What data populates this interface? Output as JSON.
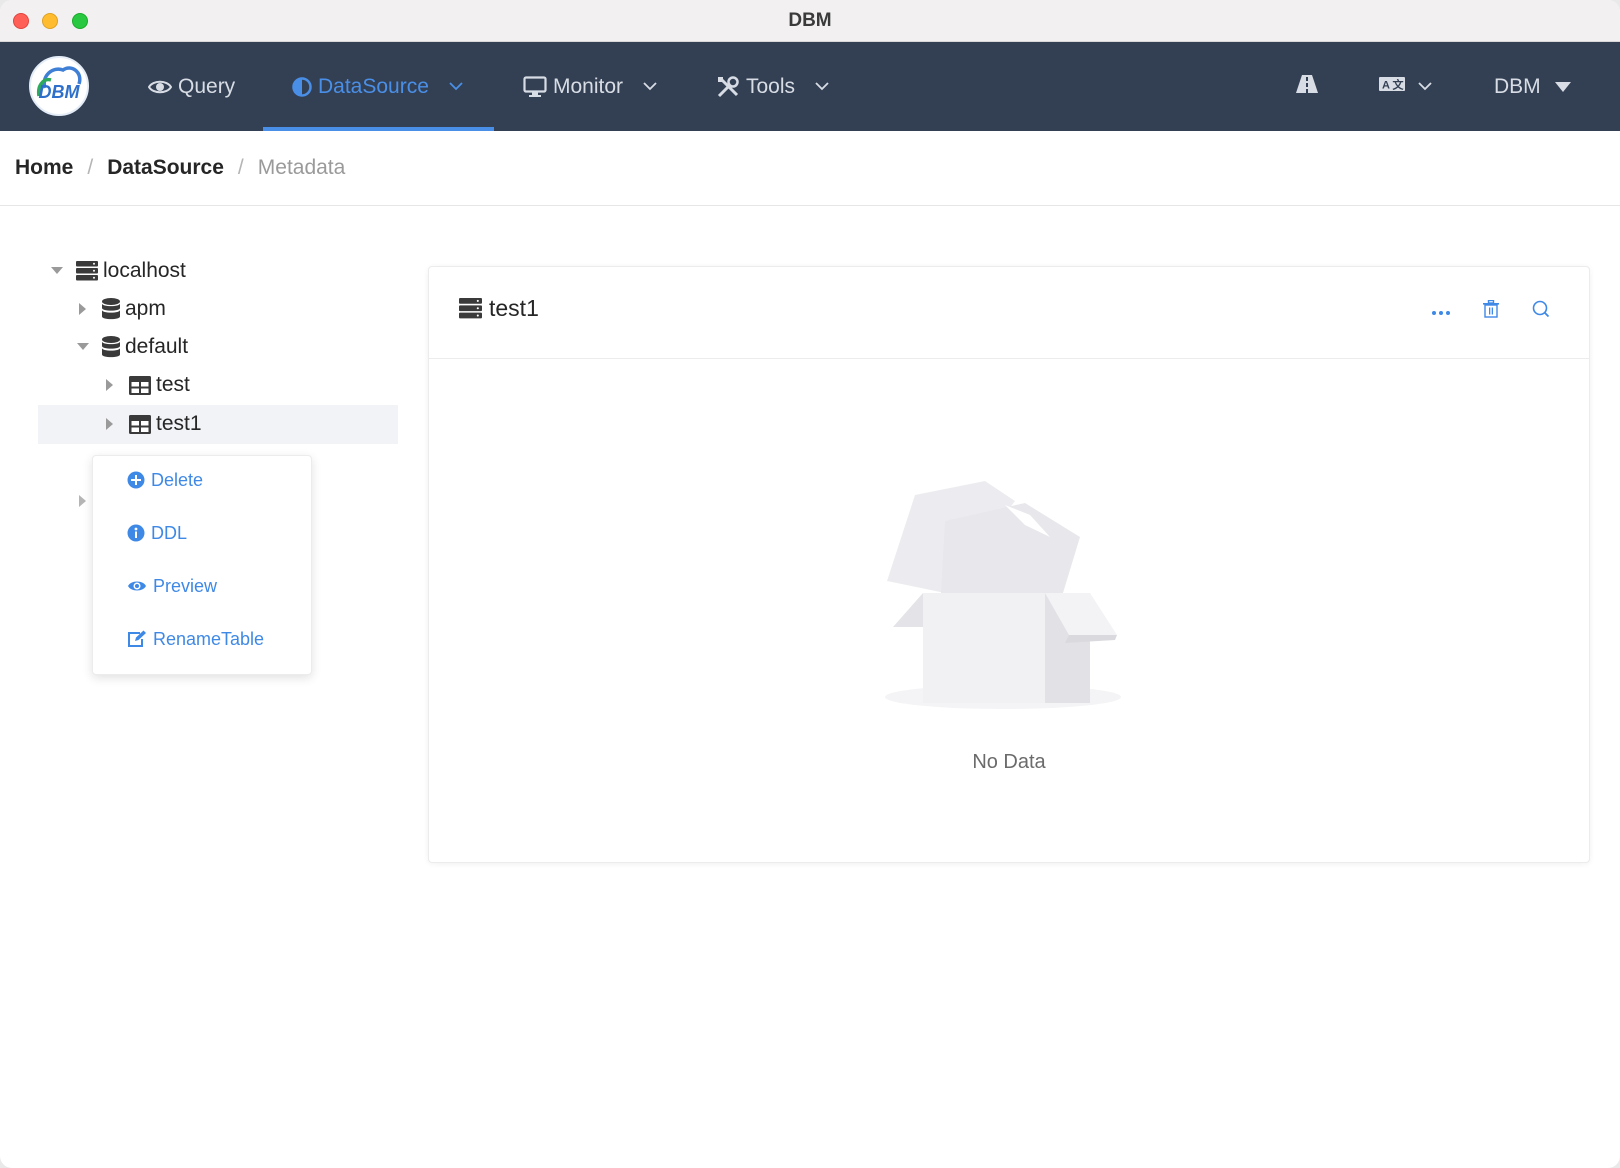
{
  "window": {
    "title": "DBM"
  },
  "nav": {
    "items": [
      {
        "label": "Query",
        "icon": "eye-icon"
      },
      {
        "label": "DataSource",
        "icon": "half-circle-icon",
        "active": true
      },
      {
        "label": "Monitor",
        "icon": "monitor-icon"
      },
      {
        "label": "Tools",
        "icon": "tools-icon"
      }
    ],
    "right": {
      "user_label": "DBM"
    },
    "active_color": "#4a8fe7",
    "bg_color": "#334054"
  },
  "breadcrumb": {
    "home": "Home",
    "section": "DataSource",
    "current": "Metadata"
  },
  "tree": {
    "nodes": [
      {
        "label": "localhost",
        "icon": "server-icon",
        "expanded": true
      },
      {
        "label": "apm",
        "icon": "database-icon",
        "expanded": false
      },
      {
        "label": "default",
        "icon": "database-icon",
        "expanded": true
      },
      {
        "label": "test",
        "icon": "table-icon",
        "expanded": false
      },
      {
        "label": "test1",
        "icon": "table-icon",
        "expanded": false,
        "selected": true
      }
    ]
  },
  "context_menu": {
    "items": [
      {
        "label": "Delete",
        "icon": "plus-circle-icon"
      },
      {
        "label": "DDL",
        "icon": "info-circle-icon"
      },
      {
        "label": "Preview",
        "icon": "eye-icon"
      },
      {
        "label": "RenameTable",
        "icon": "edit-icon"
      }
    ]
  },
  "panel": {
    "title": "test1",
    "actions": [
      "more-icon",
      "delete-icon",
      "search-icon"
    ],
    "empty_text": "No Data"
  }
}
